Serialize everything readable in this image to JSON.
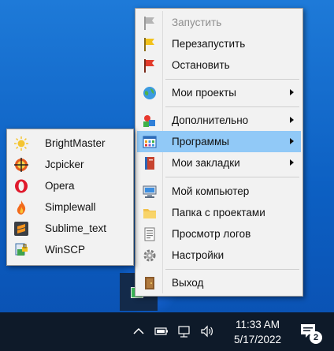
{
  "main_menu": {
    "items": [
      {
        "label": "Запустить",
        "icon": "flag-gray-icon",
        "disabled": true
      },
      {
        "label": "Перезапустить",
        "icon": "flag-yellow-icon"
      },
      {
        "label": "Остановить",
        "icon": "flag-red-icon"
      },
      {
        "label": "Мои проекты",
        "icon": "globe-icon",
        "submenu": true
      },
      {
        "label": "Дополнительно",
        "icon": "shapes-icon",
        "submenu": true
      },
      {
        "label": "Программы",
        "icon": "window-grid-icon",
        "submenu": true,
        "selected": true
      },
      {
        "label": "Мои закладки",
        "icon": "book-icon",
        "submenu": true
      },
      {
        "label": "Мой компьютер",
        "icon": "computer-icon"
      },
      {
        "label": "Папка с проектами",
        "icon": "folder-icon"
      },
      {
        "label": "Просмотр логов",
        "icon": "document-icon"
      },
      {
        "label": "Настройки",
        "icon": "gear-icon"
      },
      {
        "label": "Выход",
        "icon": "exit-door-icon"
      }
    ]
  },
  "programs_submenu": {
    "items": [
      {
        "label": "BrightMaster",
        "icon": "sun-icon"
      },
      {
        "label": "Jcpicker",
        "icon": "crosshair-icon"
      },
      {
        "label": "Opera",
        "icon": "opera-icon"
      },
      {
        "label": "Simplewall",
        "icon": "flame-icon"
      },
      {
        "label": "Sublime_text",
        "icon": "sublime-icon"
      },
      {
        "label": "WinSCP",
        "icon": "winscp-icon"
      }
    ]
  },
  "taskbar": {
    "time": "11:33 AM",
    "date": "5/17/2022",
    "notification_count": "2"
  },
  "colors": {
    "menu_bg": "#f2f2f2",
    "selected_bg": "#91c9f7",
    "taskbar_bg": "#0e1a29",
    "desktop": "#0c5fc2"
  }
}
